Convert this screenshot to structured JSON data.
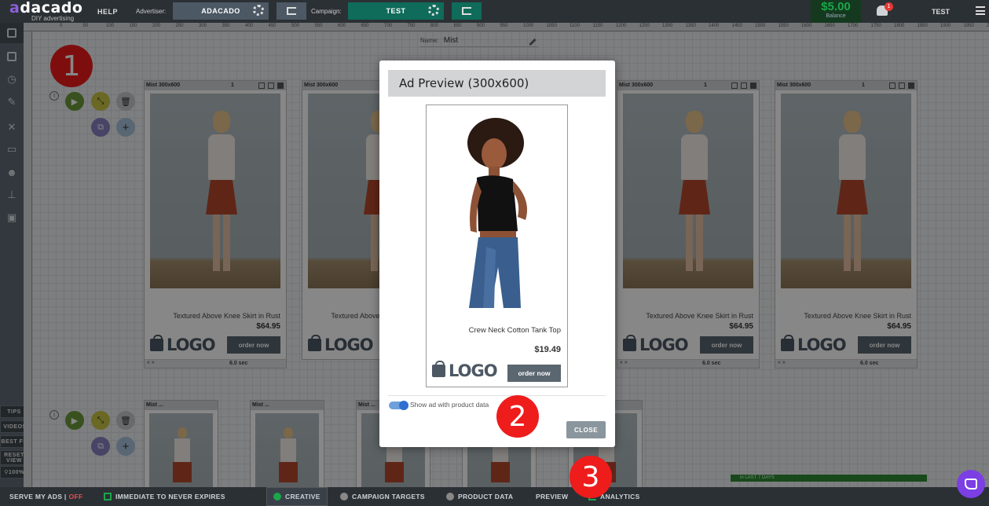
{
  "topbar": {
    "logo": "adacado",
    "logo_sub": "DIY advertising",
    "help": "HELP",
    "advertiser_label": "Advertiser:",
    "advertiser_value": "ADACADO",
    "campaign_label": "Campaign:",
    "campaign_value": "TEST",
    "balance_amount": "$5.00",
    "balance_label": "Balance",
    "notifications_count": "1",
    "user": "TEST"
  },
  "sidebar": {
    "tips": "TIPS",
    "videos": "VIDEOS",
    "best_fit": "BEST FIT",
    "reset_view": "RESET VIEW",
    "zoom": "100%"
  },
  "ruler_ticks": [
    "0",
    "50",
    "100",
    "150",
    "200",
    "250",
    "300",
    "350",
    "400",
    "450",
    "500",
    "550",
    "600",
    "650",
    "700",
    "750",
    "800",
    "850",
    "900",
    "950",
    "1000",
    "1050",
    "1100",
    "1150",
    "1200",
    "1250",
    "1300",
    "1350",
    "1400",
    "1450",
    "1500",
    "1550",
    "1600",
    "1650",
    "1700",
    "1750",
    "1800",
    "1850",
    "1900",
    "1950",
    "2000"
  ],
  "canvas": {
    "name_label": "Name:",
    "name_value": "Mist",
    "step1": "1",
    "step2": "2",
    "step3": "3",
    "card_label": "Mist 300x600",
    "card_count": "1",
    "card_title": "Textured Above Knee Skirt in Rust",
    "card_price": "$64.95",
    "card_logo": "LOGO",
    "card_order": "order now",
    "card_time": "6.0 sec",
    "mini_label": "Mist ...",
    "mini_count": "1"
  },
  "modal": {
    "title": "Ad Preview (300x600)",
    "ad_title": "Crew Neck Cotton Tank Top",
    "ad_price": "$19.49",
    "ad_logo": "LOGO",
    "ad_order": "order now",
    "toggle_label": "Show ad with product data",
    "toggle_on": true,
    "close": "CLOSE"
  },
  "bottombar": {
    "serve": "SERVE MY ADS |",
    "serve_state": "OFF",
    "schedule": "IMMEDIATE TO NEVER EXPIRES",
    "creative": "CREATIVE",
    "targets": "CAMPAIGN TARGETS",
    "product_data": "PRODUCT DATA",
    "preview": "PREVIEW",
    "analytics": "ANALYTICS",
    "strip_label": "in LAST 7 DAYS"
  },
  "colors": {
    "accent_purple": "#7b3fe4",
    "balance_green": "#1aa64a",
    "step_red": "#ef1c1c",
    "camp_teal": "#0f6b5a"
  }
}
